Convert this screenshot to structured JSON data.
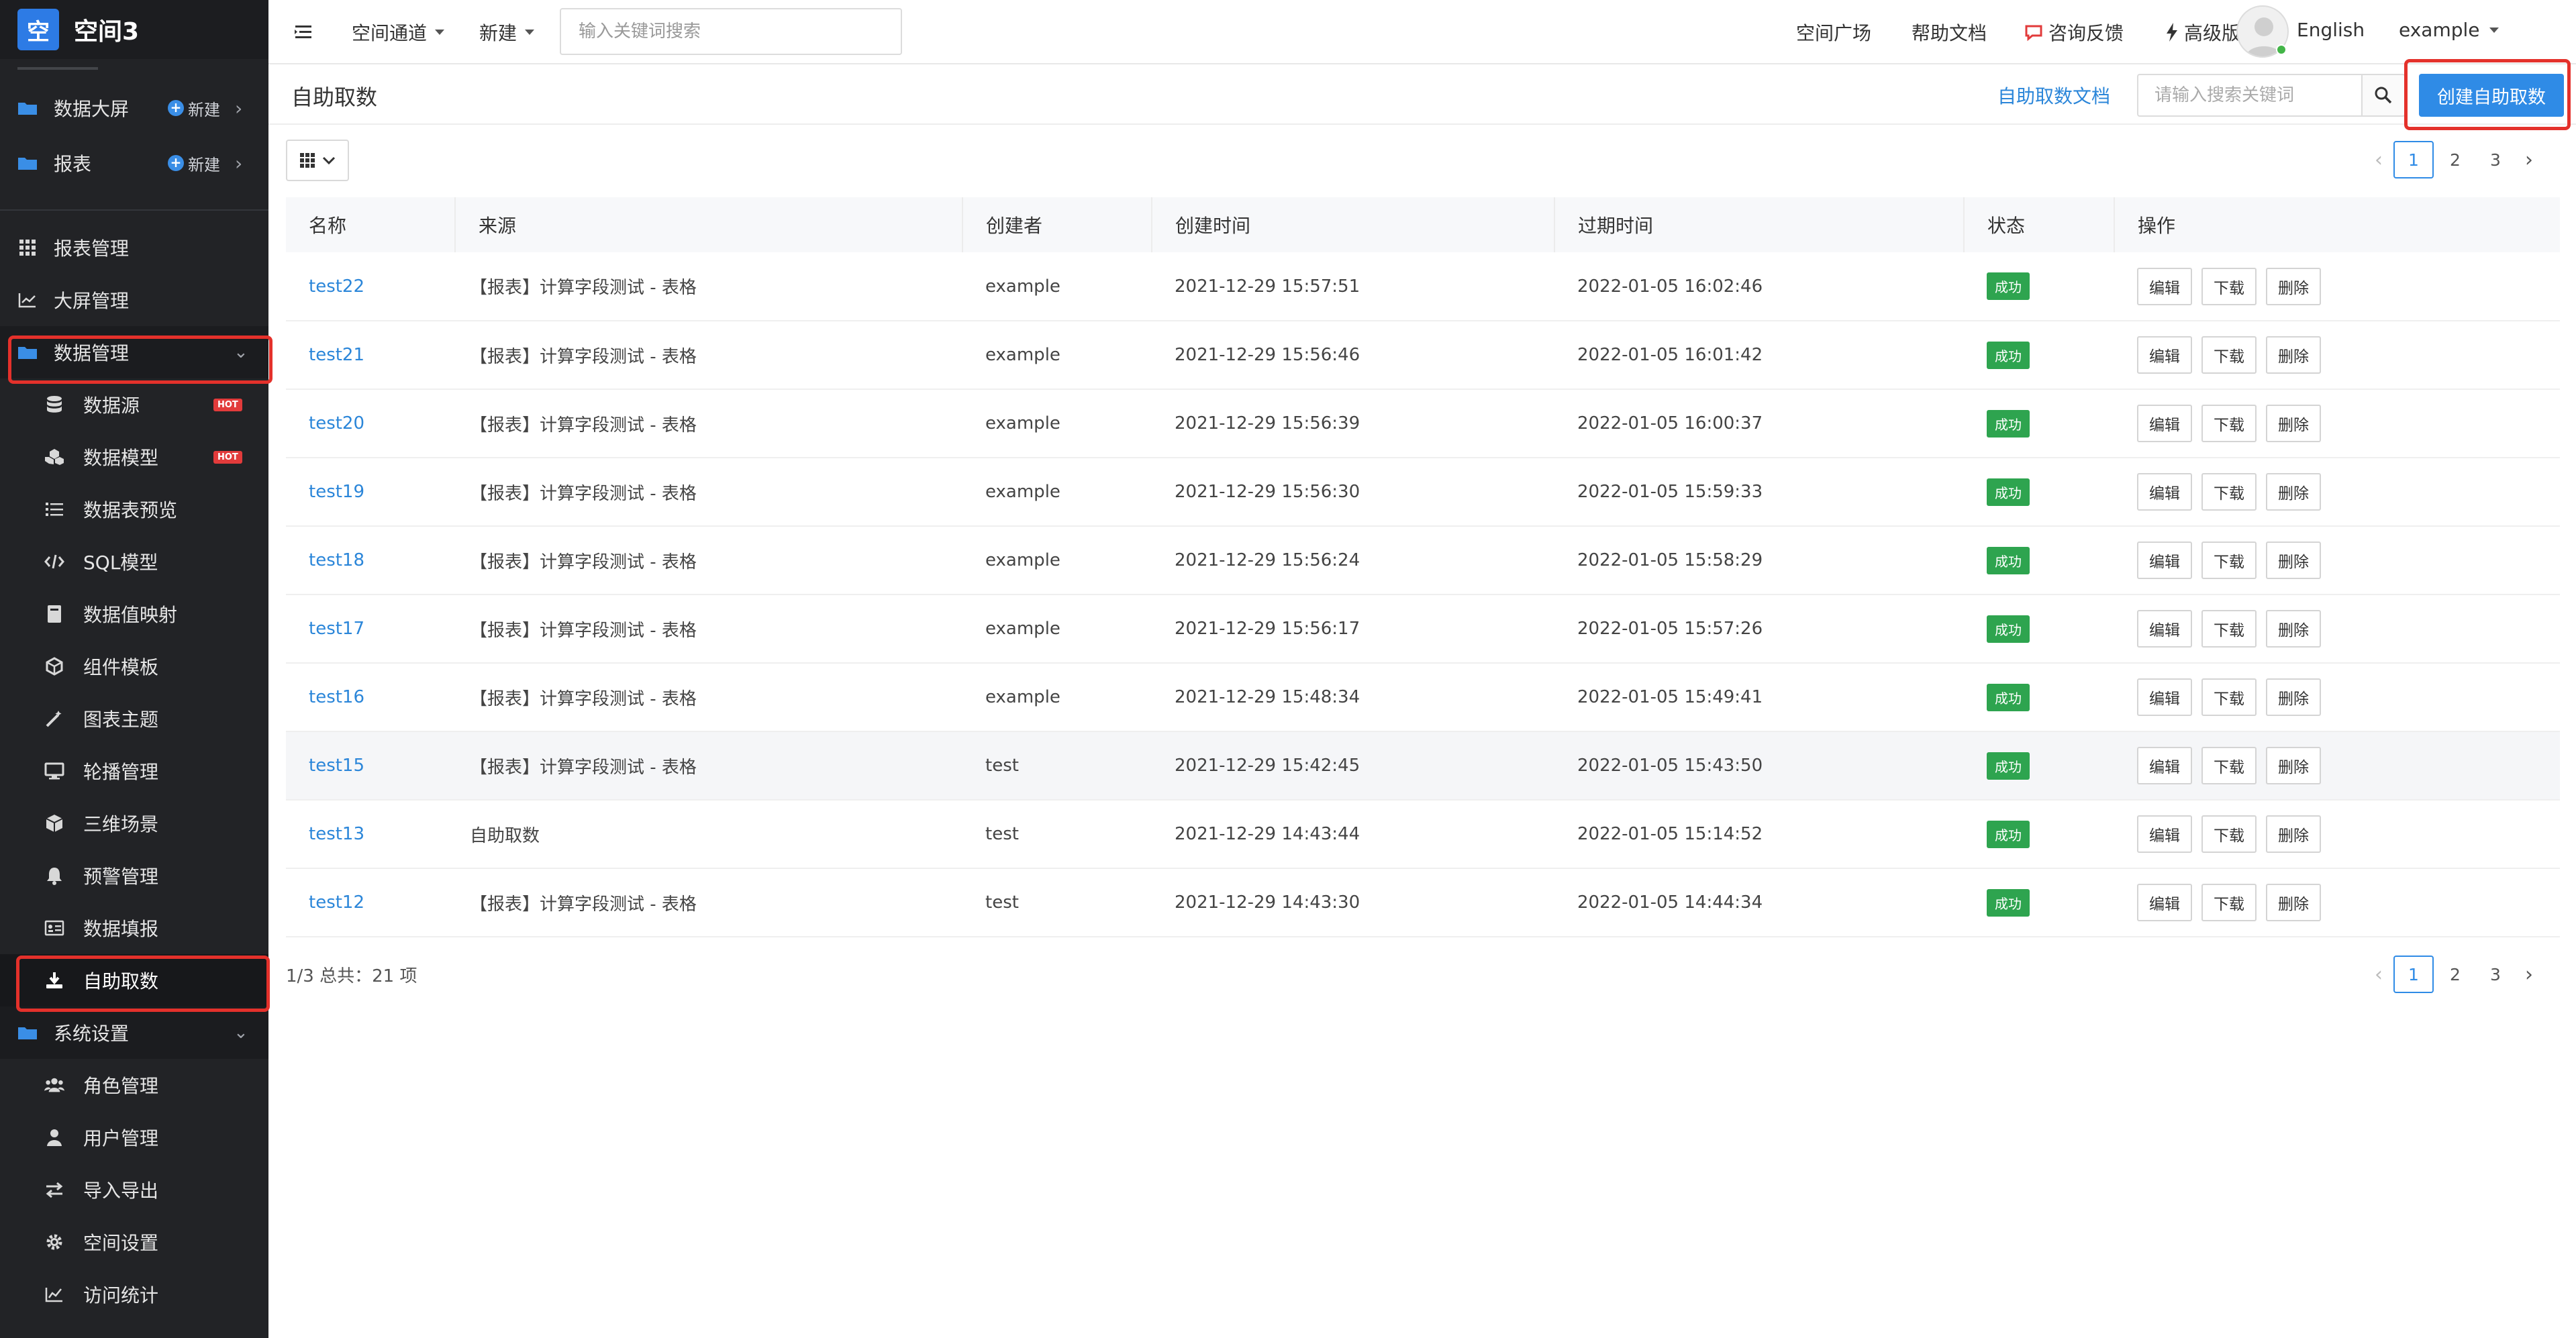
{
  "brand": {
    "logo_char": "空",
    "name": "空间3"
  },
  "sidebar": {
    "top_items": [
      {
        "label": "数据大屏",
        "new_label": "新建"
      },
      {
        "label": "报表",
        "new_label": "新建"
      }
    ],
    "nav": [
      {
        "label": "报表管理",
        "icon": "grid-icon",
        "level": 1
      },
      {
        "label": "大屏管理",
        "icon": "line-chart-icon",
        "level": 1
      },
      {
        "label": "数据管理",
        "icon": "folder-icon",
        "level": 1,
        "expanded": true
      },
      {
        "label": "数据源",
        "icon": "database-icon",
        "level": 2,
        "badge": "HOT"
      },
      {
        "label": "数据模型",
        "icon": "cubes-icon",
        "level": 2,
        "badge": "HOT"
      },
      {
        "label": "数据表预览",
        "icon": "list-icon",
        "level": 2
      },
      {
        "label": "SQL模型",
        "icon": "code-icon",
        "level": 2
      },
      {
        "label": "数据值映射",
        "icon": "book-icon",
        "level": 2
      },
      {
        "label": "组件模板",
        "icon": "component-icon",
        "level": 2
      },
      {
        "label": "图表主题",
        "icon": "magic-icon",
        "level": 2
      },
      {
        "label": "轮播管理",
        "icon": "monitor-icon",
        "level": 2
      },
      {
        "label": "三维场景",
        "icon": "cube-icon",
        "level": 2
      },
      {
        "label": "预警管理",
        "icon": "bell-icon",
        "level": 2
      },
      {
        "label": "数据填报",
        "icon": "form-icon",
        "level": 2
      },
      {
        "label": "自助取数",
        "icon": "download-icon",
        "level": 2,
        "active": true
      },
      {
        "label": "系统设置",
        "icon": "folder-icon",
        "level": 1,
        "expanded": true
      },
      {
        "label": "角色管理",
        "icon": "users-icon",
        "level": 2
      },
      {
        "label": "用户管理",
        "icon": "user-icon",
        "level": 2
      },
      {
        "label": "导入导出",
        "icon": "swap-icon",
        "level": 2
      },
      {
        "label": "空间设置",
        "icon": "gear-icon",
        "level": 2
      },
      {
        "label": "访问统计",
        "icon": "stats-icon",
        "level": 2
      }
    ]
  },
  "topbar": {
    "channel": "空间通道",
    "create": "新建",
    "search_placeholder": "输入关键词搜索",
    "plaza": "空间广场",
    "help": "帮助文档",
    "feedback": "咨询反馈",
    "pro": "高级版",
    "language": "English",
    "user": "example"
  },
  "page": {
    "title": "自助取数",
    "doc_link": "自助取数文档",
    "search_placeholder": "请输入搜索关键词",
    "create_button": "创建自助取数"
  },
  "pagination": {
    "pages": [
      "1",
      "2",
      "3"
    ],
    "current": "1"
  },
  "table": {
    "headers": [
      "名称",
      "来源",
      "创建者",
      "创建时间",
      "过期时间",
      "状态",
      "操作"
    ],
    "actions": [
      "编辑",
      "下载",
      "删除"
    ],
    "rows": [
      {
        "name": "test22",
        "source": "【报表】计算字段测试 - 表格",
        "creator": "example",
        "created": "2021-12-29 15:57:51",
        "expires": "2022-01-05 16:02:46",
        "status": "成功"
      },
      {
        "name": "test21",
        "source": "【报表】计算字段测试 - 表格",
        "creator": "example",
        "created": "2021-12-29 15:56:46",
        "expires": "2022-01-05 16:01:42",
        "status": "成功"
      },
      {
        "name": "test20",
        "source": "【报表】计算字段测试 - 表格",
        "creator": "example",
        "created": "2021-12-29 15:56:39",
        "expires": "2022-01-05 16:00:37",
        "status": "成功"
      },
      {
        "name": "test19",
        "source": "【报表】计算字段测试 - 表格",
        "creator": "example",
        "created": "2021-12-29 15:56:30",
        "expires": "2022-01-05 15:59:33",
        "status": "成功"
      },
      {
        "name": "test18",
        "source": "【报表】计算字段测试 - 表格",
        "creator": "example",
        "created": "2021-12-29 15:56:24",
        "expires": "2022-01-05 15:58:29",
        "status": "成功"
      },
      {
        "name": "test17",
        "source": "【报表】计算字段测试 - 表格",
        "creator": "example",
        "created": "2021-12-29 15:56:17",
        "expires": "2022-01-05 15:57:26",
        "status": "成功"
      },
      {
        "name": "test16",
        "source": "【报表】计算字段测试 - 表格",
        "creator": "example",
        "created": "2021-12-29 15:48:34",
        "expires": "2022-01-05 15:49:41",
        "status": "成功"
      },
      {
        "name": "test15",
        "source": "【报表】计算字段测试 - 表格",
        "creator": "test",
        "created": "2021-12-29 15:42:45",
        "expires": "2022-01-05 15:43:50",
        "status": "成功"
      },
      {
        "name": "test13",
        "source": "自助取数",
        "creator": "test",
        "created": "2021-12-29 14:43:44",
        "expires": "2022-01-05 15:14:52",
        "status": "成功"
      },
      {
        "name": "test12",
        "source": "【报表】计算字段测试 - 表格",
        "creator": "test",
        "created": "2021-12-29 14:43:30",
        "expires": "2022-01-05 14:44:34",
        "status": "成功"
      }
    ]
  },
  "summary": "1/3 总共：21 项",
  "colors": {
    "accent": "#2f8be6",
    "success": "#2ea44f",
    "sidebar": "#222326",
    "highlight": "#e4312b",
    "hot": "#e23b3b"
  }
}
